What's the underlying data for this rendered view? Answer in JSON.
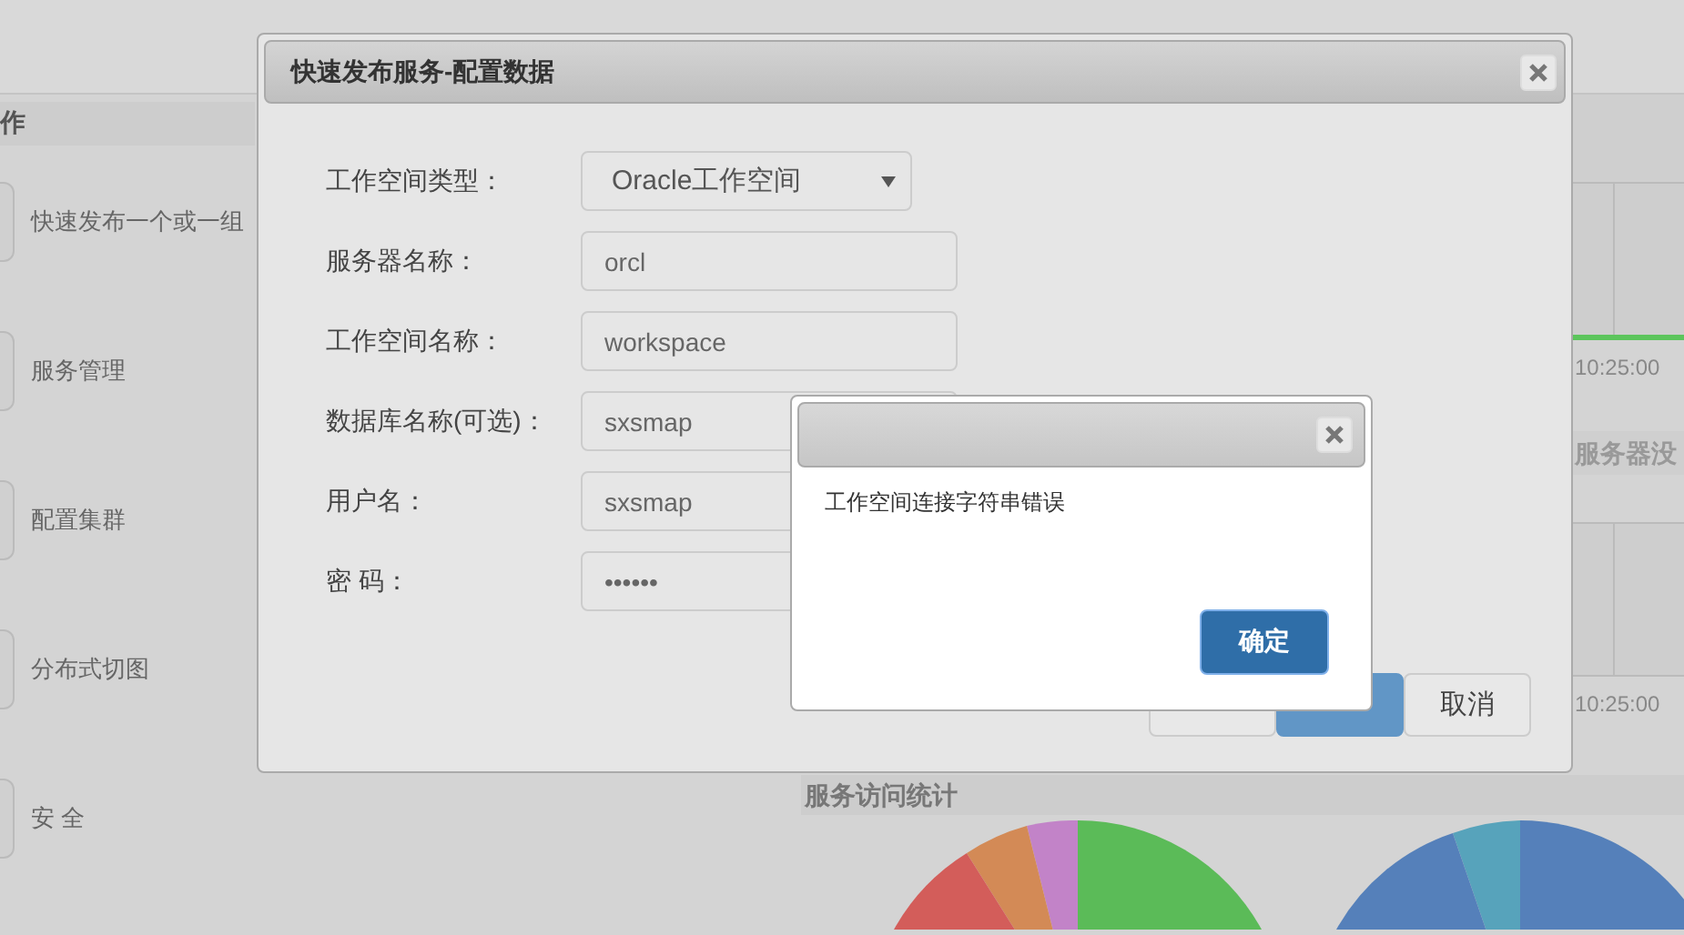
{
  "sidebar": {
    "title": "作",
    "items": [
      {
        "label": "快速发布一个或一组"
      },
      {
        "label": "服务管理"
      },
      {
        "label": "配置集群"
      },
      {
        "label": "分布式切图"
      },
      {
        "label": "安 全"
      }
    ]
  },
  "monitor": {
    "panels": [
      {
        "time": "10:25:00",
        "active": true
      },
      {
        "title": "服务器没",
        "time": "10:25:00",
        "active": false
      }
    ],
    "section_title": "服务访问统计"
  },
  "dialog": {
    "title": "快速发布服务-配置数据",
    "fields": [
      {
        "label": "工作空间类型：",
        "kind": "select",
        "value": "Oracle工作空间"
      },
      {
        "label": "服务器名称：",
        "kind": "text",
        "value": "orcl"
      },
      {
        "label": "工作空间名称：",
        "kind": "text",
        "value": "workspace"
      },
      {
        "label": "数据库名称(可选)：",
        "kind": "text",
        "value": "sxsmap"
      },
      {
        "label": "用户名：",
        "kind": "text",
        "value": "sxsmap"
      },
      {
        "label": "密 码：",
        "kind": "text",
        "value": "••••••"
      }
    ],
    "buttons": [
      {
        "kind": "default"
      },
      {
        "kind": "primary"
      },
      {
        "kind": "default",
        "label": "取消"
      }
    ]
  },
  "alert": {
    "message": "工作空间连接字符串错误",
    "button": "确定"
  }
}
